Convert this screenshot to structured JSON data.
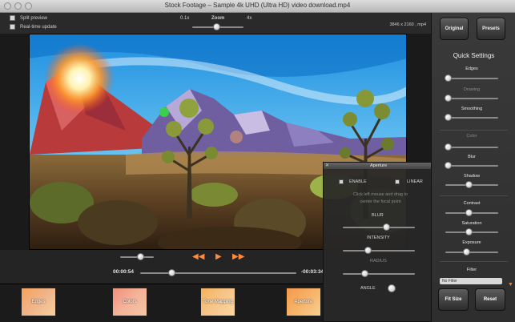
{
  "window": {
    "title": "Stock Footage – Sample 4k UHD (Ultra HD) video download.mp4"
  },
  "toolbar": {
    "split_preview": "Split preview",
    "realtime_update": "Real-time update",
    "zoom_label": "Zoom",
    "zoom_min": "0.1x",
    "zoom_max": "4x",
    "zoom_level": 0.48,
    "dimensions": "3846 x 2160 , mp4"
  },
  "panel": {
    "original": "Original",
    "presets": "Presets",
    "title": "Quick Settings",
    "edges_label": "Edges",
    "drawing_label": "Drawing",
    "smoothing_label": "Smoothing",
    "color_label": "Color",
    "blur_label": "Blur",
    "shadow_label": "Shadow",
    "contrast_label": "Contrast",
    "saturation_label": "Saturation",
    "exposure_label": "Exposure",
    "filter_label": "Filter",
    "filter_value": "No Filter",
    "fit_size": "Fit Size",
    "reset": "Reset",
    "sliders": {
      "edges": 0.05,
      "drawing": 0.05,
      "smoothing": 0.05,
      "color": 0.05,
      "blur": 0.05,
      "shadow": 0.45,
      "contrast": 0.45,
      "saturation": 0.45,
      "exposure": 0.4
    }
  },
  "transport": {
    "current_time": "00:00:54",
    "remaining_time": "-00:03:34",
    "progress": 0.2,
    "volume": 0.6
  },
  "filters": [
    "Edges",
    "Colors",
    "Tone Mapping",
    "Aperture"
  ],
  "aperture": {
    "title": "Aperture",
    "enable": "ENABLE",
    "linear": "LINEAR",
    "hint": "Click left mouse and drag to center the focal point",
    "blur": "BLUR",
    "intensity": "INTENSITY",
    "radius": "RADIUS",
    "angle": "ANGLE",
    "blur_value": 0.6,
    "intensity_value": 0.35,
    "radius_value": 0.3
  }
}
